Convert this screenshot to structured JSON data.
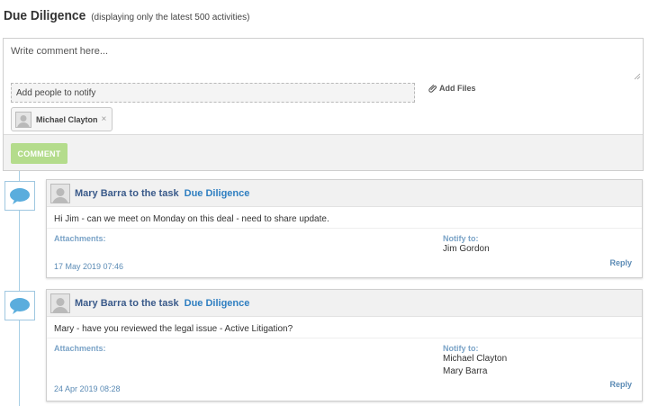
{
  "header": {
    "title": "Due Diligence",
    "subtitle": "(displaying only the latest 500 activities)"
  },
  "composer": {
    "comment_placeholder": "Write comment here...",
    "notify_placeholder": "Add people to notify",
    "add_files_label": "Add Files",
    "chips": [
      {
        "label": "Michael Clayton",
        "remove_symbol": "×"
      }
    ],
    "comment_button_label": "COMMENT"
  },
  "activities": [
    {
      "author": "Mary Barra",
      "action": "to the task",
      "task": "Due Diligence",
      "body": "Hi Jim - can we meet on Monday on this deal - need to share update.",
      "attachments_label": "Attachments:",
      "notify_label": "Notify to:",
      "notify_to": [
        "Jim Gordon"
      ],
      "timestamp": "17 May 2019 07:46",
      "reply_label": "Reply"
    },
    {
      "author": "Mary Barra",
      "action": "to the task",
      "task": "Due Diligence",
      "body": "Mary - have you reviewed the legal issue - Active Litigation?",
      "attachments_label": "Attachments:",
      "notify_label": "Notify to:",
      "notify_to": [
        "Michael Clayton",
        "Mary Barra"
      ],
      "timestamp": "24 Apr 2019 08:28",
      "reply_label": "Reply"
    }
  ],
  "colors": {
    "accent_blue": "#2f7fc1",
    "comment_button_green": "#b4dc8c",
    "timeline_blue": "#9fc7e0",
    "bubble_fill": "#5aaddd"
  },
  "icons": {
    "attach": "paperclip-icon",
    "comment_bubble": "speech-bubble-icon",
    "avatar": "user-avatar-icon",
    "resize": "resize-grip-icon"
  }
}
